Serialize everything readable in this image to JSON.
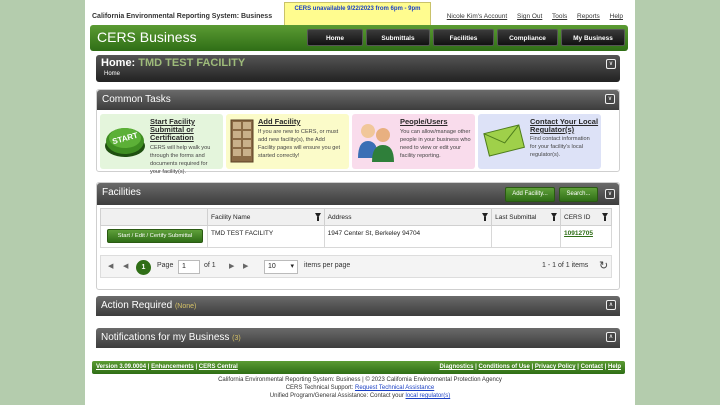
{
  "header": {
    "system_title": "California Environmental Reporting System: Business",
    "alert": "CERS unavailable 9/22/2023 from 6pm - 9pm",
    "user_account": "Nicole Kim's Account",
    "sign_out": "Sign Out",
    "tools": "Tools",
    "reports": "Reports",
    "help": "Help"
  },
  "banner": {
    "brand": "CERS Business",
    "nav": [
      "Home",
      "Submittals",
      "Facilities",
      "Compliance",
      "My Business"
    ]
  },
  "home": {
    "title": "Home:",
    "facility": "TMD TEST FACILITY",
    "breadcrumb": "Home"
  },
  "common_tasks": {
    "title": "Common Tasks",
    "start_icon": "START",
    "tasks": [
      {
        "title_1": "Start Facility",
        "title_2": "Submittal or",
        "title_3": "Certification",
        "desc": [
          "CERS will help walk you",
          "through the forms and",
          "documents required for",
          "your facility(s)."
        ]
      },
      {
        "title_1": "Add Facility",
        "desc": [
          "If you are new to CERS, or must",
          "add new facility(s), the Add",
          "Facility pages will ensure you get",
          "started correctly!"
        ]
      },
      {
        "title_1": "People/Users",
        "desc": [
          "You can allow/manage other",
          "people in your business who",
          "need to view or edit your",
          "facility reporting."
        ]
      },
      {
        "title_1": "Contact Your Local",
        "title_2": "Regulator(s)",
        "desc": [
          "Find contact information",
          "for your facility's local",
          "regulator(s)."
        ]
      }
    ]
  },
  "facilities": {
    "title": "Facilities",
    "add_button": "Add Facility...",
    "search_button": "Search...",
    "columns": [
      "Facility Name",
      "Address",
      "Last Submittal",
      "CERS ID"
    ],
    "rows": [
      {
        "action": "Start / Edit / Certify Submittal",
        "name": "TMD TEST FACILITY",
        "address": "1947 Center St, Berkeley 94704",
        "last_submittal": "",
        "cers_id": "10912705"
      }
    ],
    "pager": {
      "current_page": "1",
      "page_label": "Page",
      "page_input": "1",
      "of_label": "of 1",
      "page_size": "10",
      "items_per_page": "items per page",
      "summary": "1 - 1 of 1 items"
    }
  },
  "action_required": {
    "title": "Action Required",
    "sub": "(None)"
  },
  "notifications": {
    "title": "Notifications for my Business",
    "sub": "(3)"
  },
  "footer": {
    "version": "Version 3.09.0004",
    "enhancements": "Enhancements",
    "cers_central": "CERS Central",
    "diagnostics": "Diagnostics",
    "conditions": "Conditions of Use",
    "privacy": "Privacy Policy",
    "contact": "Contact",
    "help": "Help",
    "sep": "|",
    "copyright": "California Environmental Reporting System: Business | © 2023 California Environmental Protection Agency",
    "support_label": "CERS Technical Support:",
    "support_link": "Request Technical Assistance",
    "general_label": "Unified Program/General Assistance: Contact your",
    "general_link": "local regulator(s)"
  }
}
